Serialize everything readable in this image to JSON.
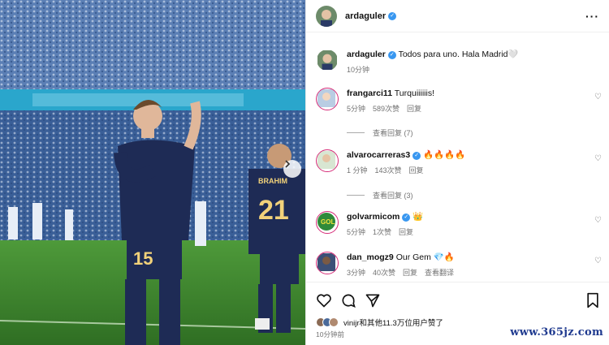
{
  "post": {
    "author": "ardaguler",
    "caption": "Todos para uno. Hala Madrid🤍",
    "caption_time": "10分钟",
    "photo_jersey_left": "15",
    "photo_jersey_right": "21",
    "photo_name_right": "BRAHIM"
  },
  "comments": [
    {
      "user": "frangarci11",
      "text": "Turquiiiiiis!",
      "verified": false,
      "time": "5分钟",
      "likes": "589次赞",
      "reply": "回复",
      "view_replies": "查看回复 (7)"
    },
    {
      "user": "alvarocarreras3",
      "text": "🔥🔥🔥🔥",
      "verified": true,
      "time": "1 分钟",
      "likes": "143次赞",
      "reply": "回复",
      "view_replies": "查看回复 (3)"
    },
    {
      "user": "golvarmicom",
      "text": "👑",
      "verified": true,
      "time": "5分钟",
      "likes": "1次赞",
      "reply": "回复"
    },
    {
      "user": "dan_mogz9",
      "text": "Our Gem 💎🔥",
      "verified": false,
      "time": "3分钟",
      "likes": "40次赞",
      "reply": "回复",
      "translate": "查看翻译"
    }
  ],
  "footer": {
    "likes_text": "vinijr和其他11.3万位用户赞了",
    "posted": "10分钟前"
  },
  "icons": [
    "more-icon",
    "heart-icon",
    "comment-icon",
    "share-icon",
    "bookmark-icon",
    "chevron-right-icon"
  ],
  "colors": {
    "verified": "#3897f0",
    "story_ring": "#d62976",
    "watermark": "#1f3a8f"
  },
  "watermark": "www.365jz.com"
}
